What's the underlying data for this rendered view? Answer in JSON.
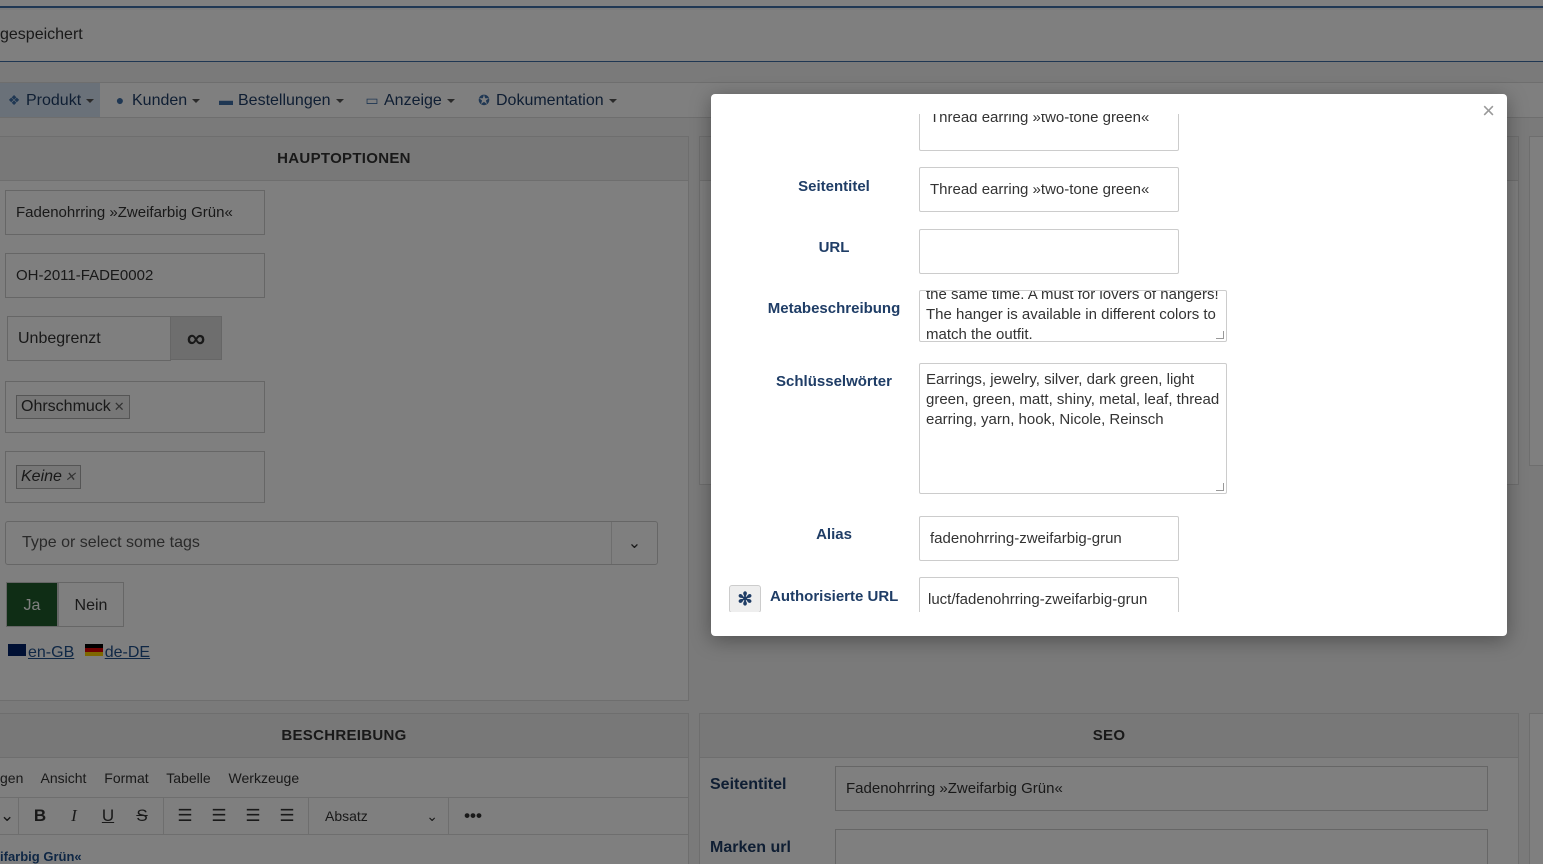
{
  "status": {
    "saved_text": "gespeichert"
  },
  "nav": {
    "items": [
      {
        "label": "Produkt",
        "icon": "cubes-icon"
      },
      {
        "label": "Kunden",
        "icon": "user-icon"
      },
      {
        "label": "Bestellungen",
        "icon": "orders-icon"
      },
      {
        "label": "Anzeige",
        "icon": "monitor-icon"
      },
      {
        "label": "Dokumentation",
        "icon": "lifering-icon"
      }
    ]
  },
  "main_options": {
    "title": "HAUPTOPTIONEN",
    "product_name": "Fadenohrring »Zweifarbig Grün«",
    "sku": "OH-2011-FADE0002",
    "stock": "Unbegrenzt",
    "category_chip": "Ohrschmuck",
    "manufacturer_chip": "Keine",
    "tags_placeholder": "Type or select some tags",
    "publish_yes": "Ja",
    "publish_no": "Nein",
    "lang_en": "en-GB",
    "lang_de": "de-DE"
  },
  "description": {
    "title": "BESCHREIBUNG",
    "menu": [
      "gen",
      "Ansicht",
      "Format",
      "Tabelle",
      "Werkzeuge"
    ],
    "format_select": "Absatz",
    "content_preview": "ifarbig Grün«"
  },
  "seo": {
    "title": "SEO",
    "page_title_label": "Seitentitel",
    "page_title_value": "Fadenohrring »Zweifarbig Grün«",
    "brand_url_label": "Marken url"
  },
  "modal": {
    "close": "×",
    "prev_value": "Thread earring »two-tone green«",
    "page_title_label": "Seitentitel",
    "page_title_value": "Thread earring »two-tone green«",
    "url_label": "URL",
    "url_value": "",
    "meta_label": "Metabeschreibung",
    "meta_value": "the same time. A must for lovers of hangers! The hanger is available in different colors to match the outfit.",
    "keywords_label": "Schlüsselwörter",
    "keywords_value": "Earrings, jewelry, silver, dark green, light green, green, matt, shiny, metal, leaf, thread earring, yarn, hook, Nicole, Reinsch",
    "alias_label": "Alias",
    "alias_value": "fadenohrring-zweifarbig-grun",
    "auth_url_label": "Authorisierte URL",
    "auth_url_value": "luct/fadenohrring-zweifarbig-grun"
  }
}
